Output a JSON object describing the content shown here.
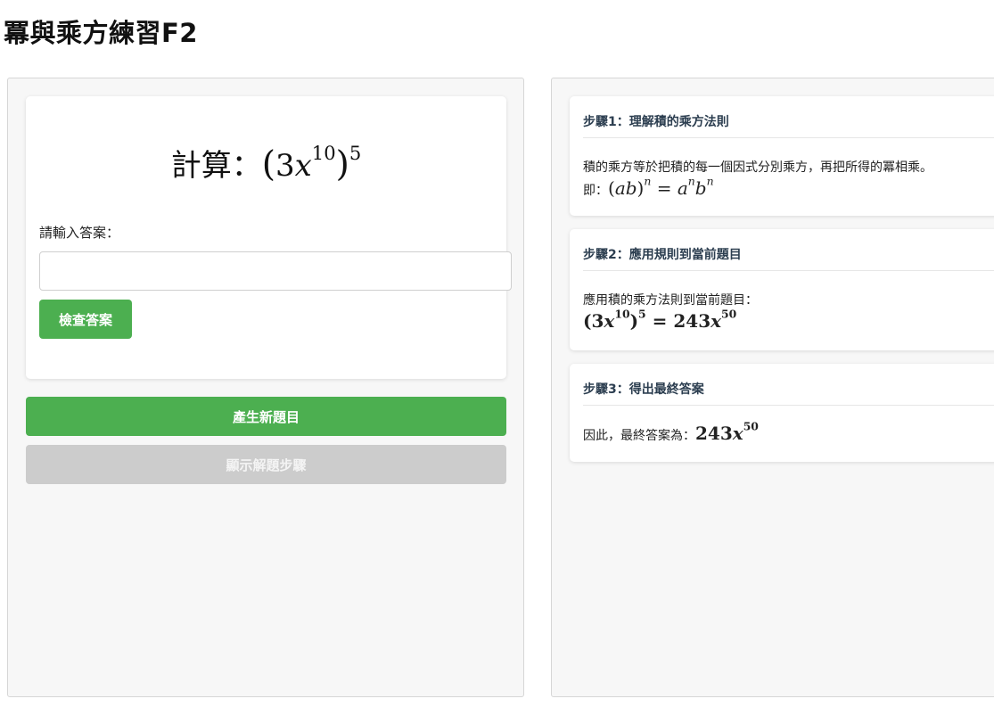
{
  "page": {
    "title": "冪與乘方練習F2"
  },
  "question": {
    "prefix": "計算：",
    "coefficient": "3",
    "variable": "x",
    "inner_exponent": "10",
    "outer_exponent": "5"
  },
  "answer": {
    "label": "請輸入答案：",
    "value": "",
    "placeholder": ""
  },
  "buttons": {
    "check": "檢查答案",
    "new_question": "產生新題目",
    "show_steps": "顯示解題步驟"
  },
  "steps": [
    {
      "title": "步驟1：理解積的乘方法則",
      "text": "積的乘方等於把積的每一個因式分別乘方，再把所得的冪相乘。",
      "lead": "即：",
      "rule": {
        "base": "ab",
        "exp": "n",
        "a": "a",
        "b": "b"
      }
    },
    {
      "title": "步驟2：應用規則到當前題目",
      "text": "應用積的乘方法則到當前題目：",
      "result_coefficient": "243",
      "result_exponent": "50"
    },
    {
      "title": "步驟3：得出最終答案",
      "text": "因此，最終答案為：",
      "result_coefficient": "243",
      "result_exponent": "50"
    }
  ],
  "colors": {
    "primary_button": "#4caf50",
    "disabled_button": "#cccccc",
    "step_title": "#2c3e50"
  }
}
